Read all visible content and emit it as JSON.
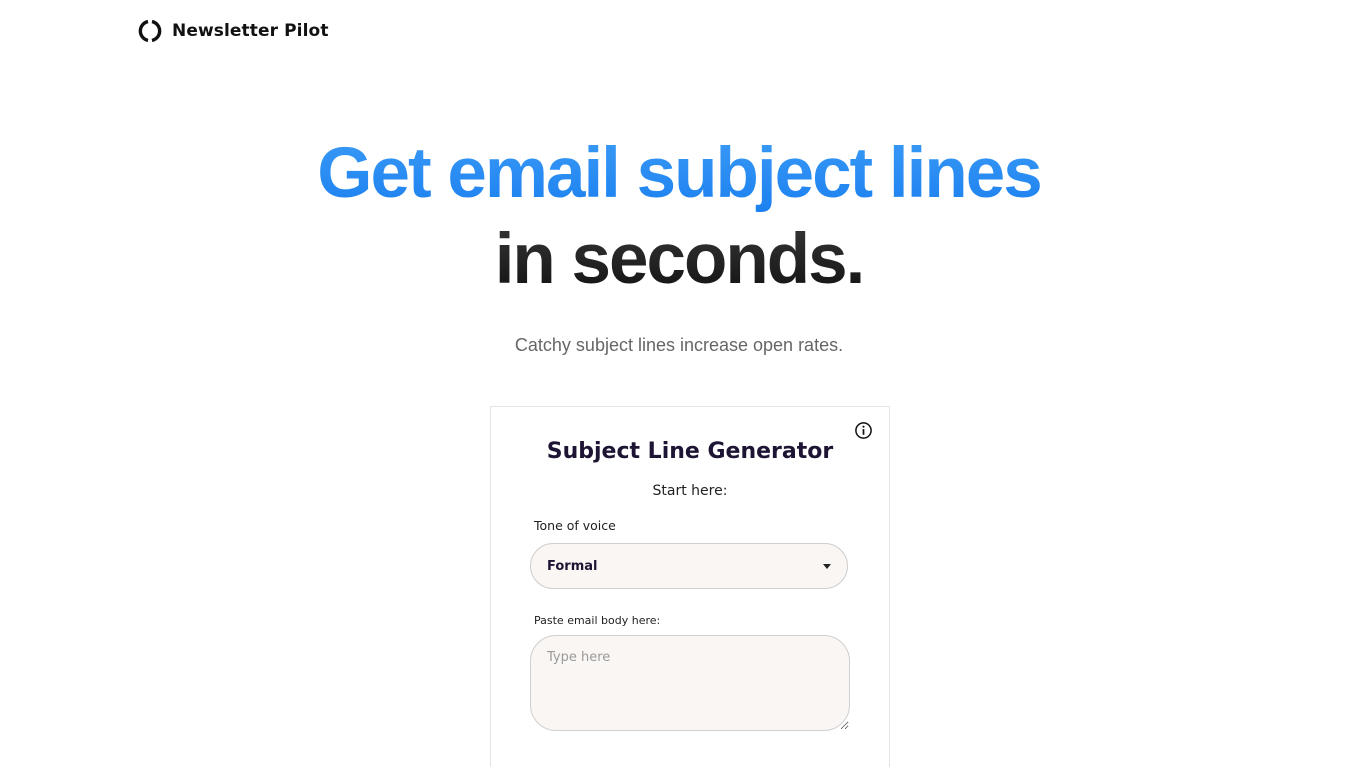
{
  "header": {
    "brand": "Newsletter Pilot",
    "logo_icon": "logo-ring-icon"
  },
  "hero": {
    "line1": "Get email subject lines",
    "line2": "in seconds.",
    "subtitle": "Catchy subject lines increase open rates.",
    "accent_color": "#2a8cf4",
    "dark_color": "#1a1a1a"
  },
  "card": {
    "info_icon": "info-icon",
    "title": "Subject Line Generator",
    "subtitle": "Start here:",
    "tone": {
      "label": "Tone of voice",
      "value": "Formal"
    },
    "body": {
      "label": "Paste email body here:",
      "placeholder": "Type here",
      "value": ""
    }
  }
}
